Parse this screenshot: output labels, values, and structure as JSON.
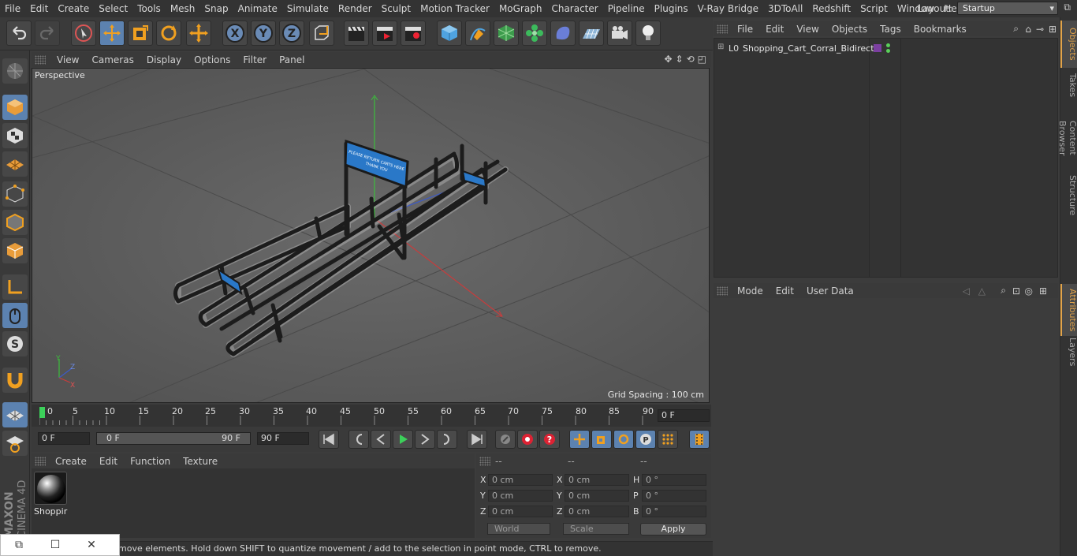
{
  "menubar": {
    "items": [
      "File",
      "Edit",
      "Create",
      "Select",
      "Tools",
      "Mesh",
      "Snap",
      "Animate",
      "Simulate",
      "Render",
      "Sculpt",
      "Motion Tracker",
      "MoGraph",
      "Character",
      "Pipeline",
      "Plugins",
      "V-Ray Bridge",
      "3DToAll",
      "Redshift",
      "Script",
      "Window",
      "Help"
    ],
    "layout_label": "Layout:",
    "layout_value": "Startup"
  },
  "viewport": {
    "menu": [
      "View",
      "Cameras",
      "Display",
      "Options",
      "Filter",
      "Panel"
    ],
    "camera_label": "Perspective",
    "grid_spacing": "Grid Spacing : 100 cm",
    "sign_text_1": "PLEASE RETURN CARTS HERE",
    "sign_text_2": "THANK YOU"
  },
  "timeline": {
    "ticks": [
      "0",
      "5",
      "10",
      "15",
      "20",
      "25",
      "30",
      "35",
      "40",
      "45",
      "50",
      "55",
      "60",
      "65",
      "70",
      "75",
      "80",
      "85",
      "90"
    ],
    "current_frame": "0 F"
  },
  "playback": {
    "start_frame": "0 F",
    "range_start": "0 F",
    "range_end": "90 F",
    "end_frame": "90 F"
  },
  "material_manager": {
    "menu": [
      "Create",
      "Edit",
      "Function",
      "Texture"
    ],
    "material_name": "Shoppir"
  },
  "coordinates": {
    "headers": [
      "--",
      "--",
      "--"
    ],
    "rows": [
      {
        "l1": "X",
        "v1": "0 cm",
        "l2": "X",
        "v2": "0 cm",
        "l3": "H",
        "v3": "0 °"
      },
      {
        "l1": "Y",
        "v1": "0 cm",
        "l2": "Y",
        "v2": "0 cm",
        "l3": "P",
        "v3": "0 °"
      },
      {
        "l1": "Z",
        "v1": "0 cm",
        "l2": "Z",
        "v2": "0 cm",
        "l3": "B",
        "v3": "0 °"
      }
    ],
    "mode_dropdown": "World",
    "size_dropdown": "Scale",
    "apply_label": "Apply"
  },
  "status": {
    "text": "move elements. Hold down SHIFT to quantize movement / add to the selection in point mode, CTRL to remove."
  },
  "object_manager": {
    "menu": [
      "File",
      "Edit",
      "View",
      "Objects",
      "Tags",
      "Bookmarks"
    ],
    "object_name": "Shopping_Cart_Corral_Bidirect"
  },
  "attributes_manager": {
    "menu": [
      "Mode",
      "Edit",
      "User Data"
    ]
  },
  "side_tabs": [
    "Objects",
    "Takes",
    "Content Browser",
    "Structure",
    "Attributes",
    "Layers"
  ],
  "colors": {
    "accent_blue": "#5c82b0",
    "active_tab": "#e2a44a",
    "sign_blue": "#2a78c8"
  }
}
